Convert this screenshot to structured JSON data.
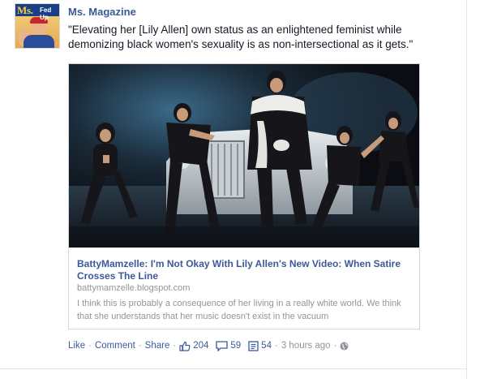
{
  "post": {
    "page_name": "Ms. Magazine",
    "avatar_text": "Ms.",
    "avatar_subtext": "Fed Up",
    "text": "\"Elevating her [Lily Allen] own status as an enlightened feminist while demonizing black women's sexuality is as non-intersectional as it gets.\""
  },
  "attachment": {
    "image_icon": "music-video-still",
    "title": "BattyMamzelle: I'm Not Okay With Lily Allen's New Video: When Satire Crosses The Line",
    "domain": "battymamzelle.blogspot.com",
    "description": "I think this is probably a consequence of her living in a really white world. We think that she understands that her music doesn't exist in the vacuum"
  },
  "actions": {
    "like": "Like",
    "comment": "Comment",
    "share": "Share",
    "sep": "·",
    "likes_count": "204",
    "comments_count": "59",
    "shares_count": "54",
    "time": "3 hours ago",
    "icons": {
      "likes": "thumbs-up-icon",
      "comments": "comment-bubble-icon",
      "shares": "share-icon",
      "privacy": "globe-icon"
    }
  },
  "colors": {
    "link": "#3b5998",
    "meta": "#90949c",
    "text": "#141823"
  }
}
